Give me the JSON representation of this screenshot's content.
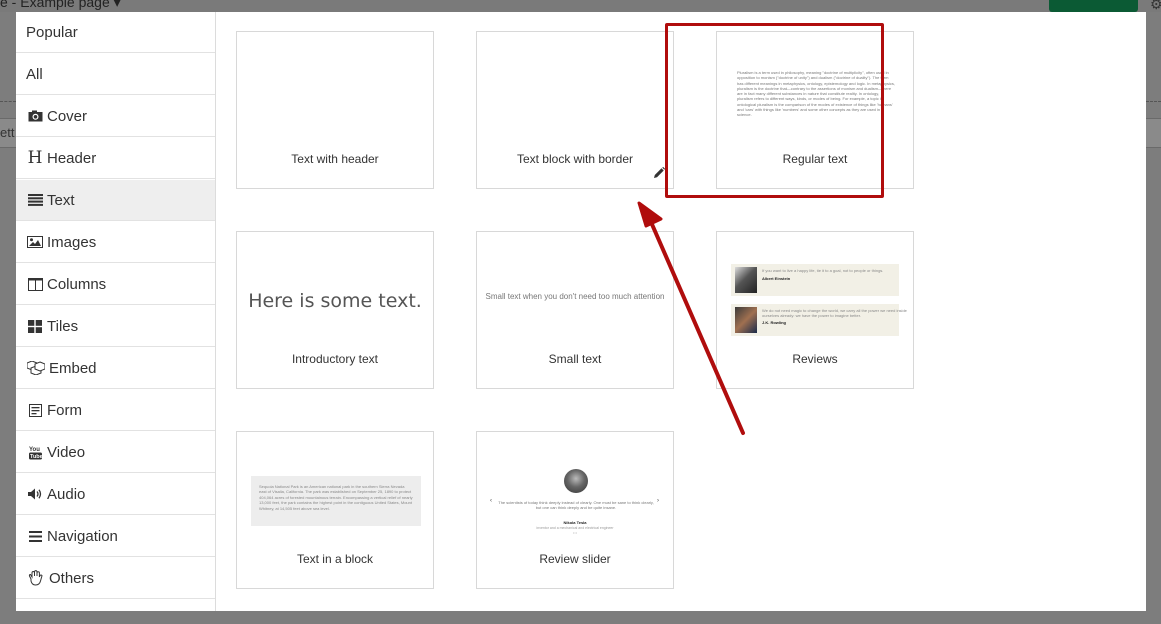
{
  "background": {
    "page_title": "e - Example page ▾",
    "left_strip_text": "ett"
  },
  "sidebar": {
    "items": [
      {
        "label": "Popular",
        "icon": ""
      },
      {
        "label": "All",
        "icon": ""
      },
      {
        "label": "Cover",
        "icon": "camera-icon"
      },
      {
        "label": "Header",
        "icon": "header-icon"
      },
      {
        "label": "Text",
        "icon": "text-lines-icon",
        "active": true
      },
      {
        "label": "Images",
        "icon": "image-icon"
      },
      {
        "label": "Columns",
        "icon": "columns-icon"
      },
      {
        "label": "Tiles",
        "icon": "tiles-icon"
      },
      {
        "label": "Embed",
        "icon": "cubes-icon"
      },
      {
        "label": "Form",
        "icon": "form-icon"
      },
      {
        "label": "Video",
        "icon": "youtube-icon"
      },
      {
        "label": "Audio",
        "icon": "speaker-icon"
      },
      {
        "label": "Navigation",
        "icon": "menu-icon"
      },
      {
        "label": "Others",
        "icon": "hand-icon"
      }
    ]
  },
  "cards": [
    {
      "label": "Text with header"
    },
    {
      "label": "Text block with border"
    },
    {
      "label": "Regular text"
    },
    {
      "label": "Introductory text"
    },
    {
      "label": "Small text"
    },
    {
      "label": "Reviews"
    },
    {
      "label": "Text in a block"
    },
    {
      "label": "Review slider"
    }
  ],
  "previews": {
    "regular_text": "Pluralism is a term used in philosophy, meaning \"doctrine of multiplicity\", often used in opposition to monism (\"doctrine of unity\") and dualism (\"doctrine of duality\"). The term has different meanings in metaphysics, ontology, epistemology and logic. In metaphysics, pluralism is the doctrine that—contrary to the assertions of monism and dualism—there are in fact many different substances in nature that constitute reality. In ontology, pluralism refers to different ways, kinds, or modes of being. For example, a topic in ontological pluralism is the comparison of the modes of existence of things like 'humans' and 'cars' with things like 'numbers' and some other concepts as they are used in science.",
    "intro_text": "Here is some text.",
    "small_text": "Small text when you don't need too much attention",
    "review1_quote": "If you want to live a happy life, tie it to a goal, not to people or things.",
    "review1_name": "Albert Einstein",
    "review2_quote_1": "We do not need magic to change the world, we carry all the power we need inside",
    "review2_quote_2": "ourselves already: we have the power to imagine better.",
    "review2_name": "J.K. Rowling",
    "block_text": "Sequoia National Park is an American national park in the southern Sierra Nevada east of Visalia, California. The park was established on September 25, 1890 to protect 404,064 acres of forested mountainous terrain. Encompassing a vertical relief of nearly 13,000 feet, the park contains the highest point in the contiguous United States, Mount Whitney, at 14,505 feet above sea level.",
    "slider_quote": "The scientists of today think deeply instead of clearly. One must be sane to think clearly, but one can think deeply and be quite insane.",
    "slider_name": "Nikola Tesla",
    "slider_sub": "inventor and a mechanical and electrical engineer",
    "slider_dots": "• •"
  },
  "colors": {
    "highlight": "#b00d0d",
    "active_category_bg": "#eeeeee",
    "overlay": "#7d7d7d"
  }
}
